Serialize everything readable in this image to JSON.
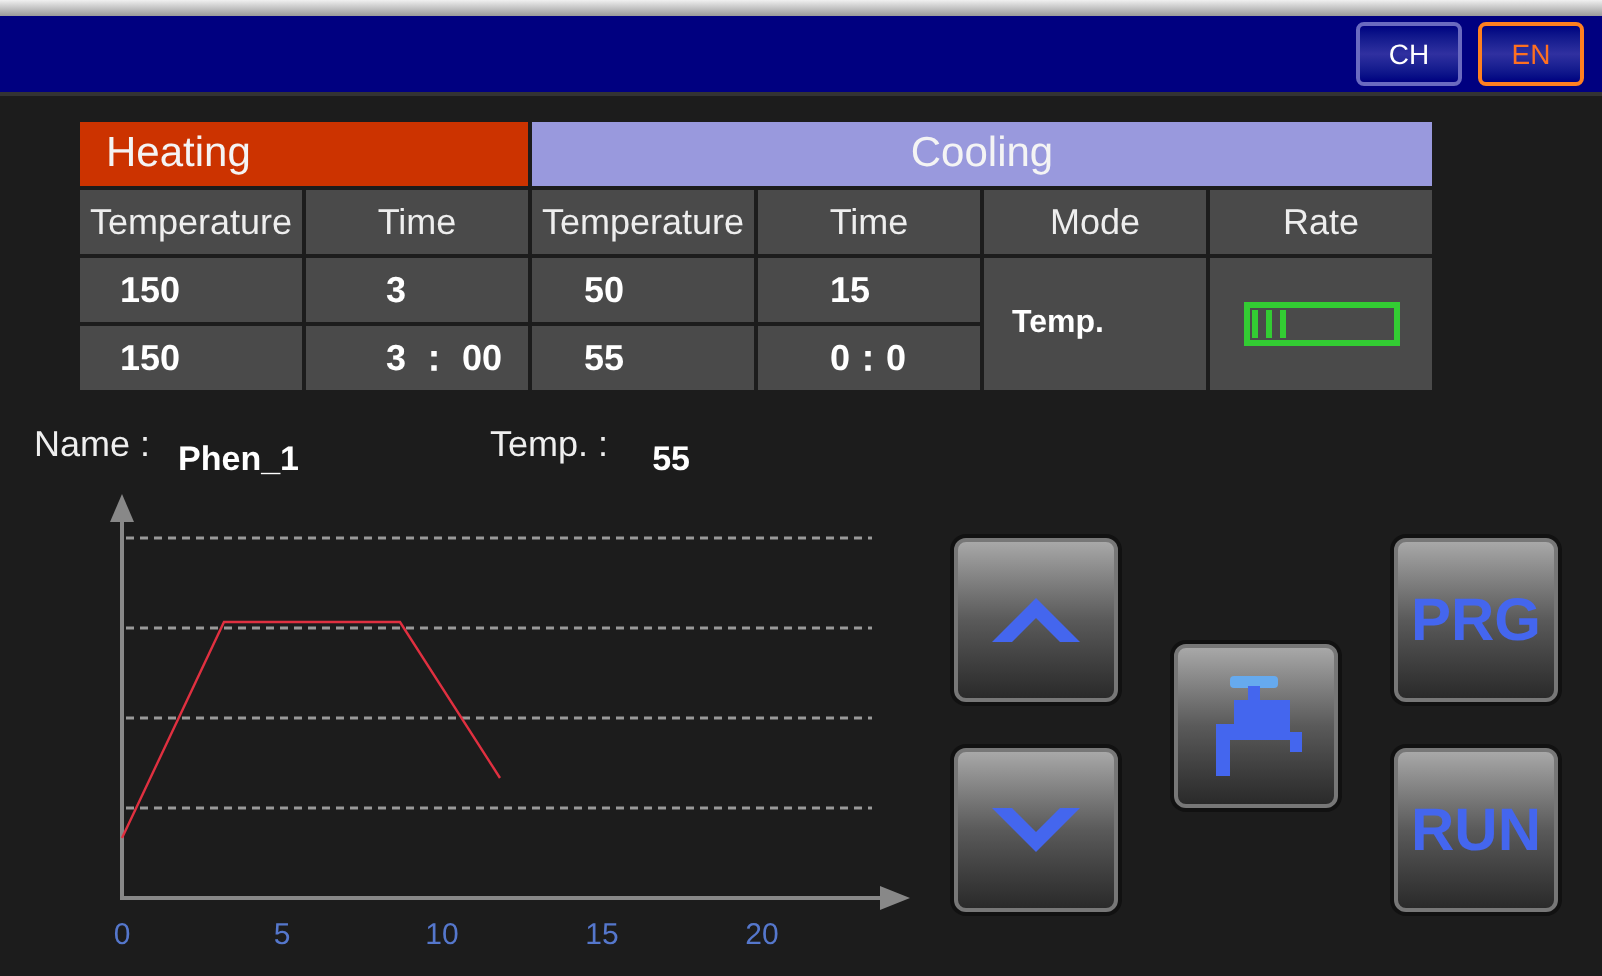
{
  "header": {
    "languages": [
      {
        "label": "CH",
        "selected": false
      },
      {
        "label": "EN",
        "selected": true
      }
    ]
  },
  "table": {
    "groups": [
      {
        "label": "Heating",
        "kind": "heating"
      },
      {
        "label": "Cooling",
        "kind": "cooling"
      }
    ],
    "columns": [
      "Temperature",
      "Time",
      "Temperature",
      "Time",
      "Mode",
      "Rate"
    ],
    "rows": [
      [
        "150",
        "3",
        "50",
        "15"
      ],
      [
        "150",
        "3 ： 00",
        "55",
        "0：0"
      ]
    ],
    "mode": "Temp.",
    "rate": {
      "level": 0.25
    }
  },
  "info": {
    "name_label": "Name :",
    "name": "Phen_1",
    "temp_label": "Temp. :",
    "temp": "55"
  },
  "chart": {
    "x_tick_labels": [
      "0",
      "5",
      "10",
      "15",
      "20"
    ]
  },
  "buttons": [
    {
      "kind": "up"
    },
    {
      "kind": "down"
    },
    {
      "kind": "tap"
    },
    {
      "kind": "text",
      "label": "PRG"
    },
    {
      "kind": "text",
      "label": "RUN"
    }
  ]
}
